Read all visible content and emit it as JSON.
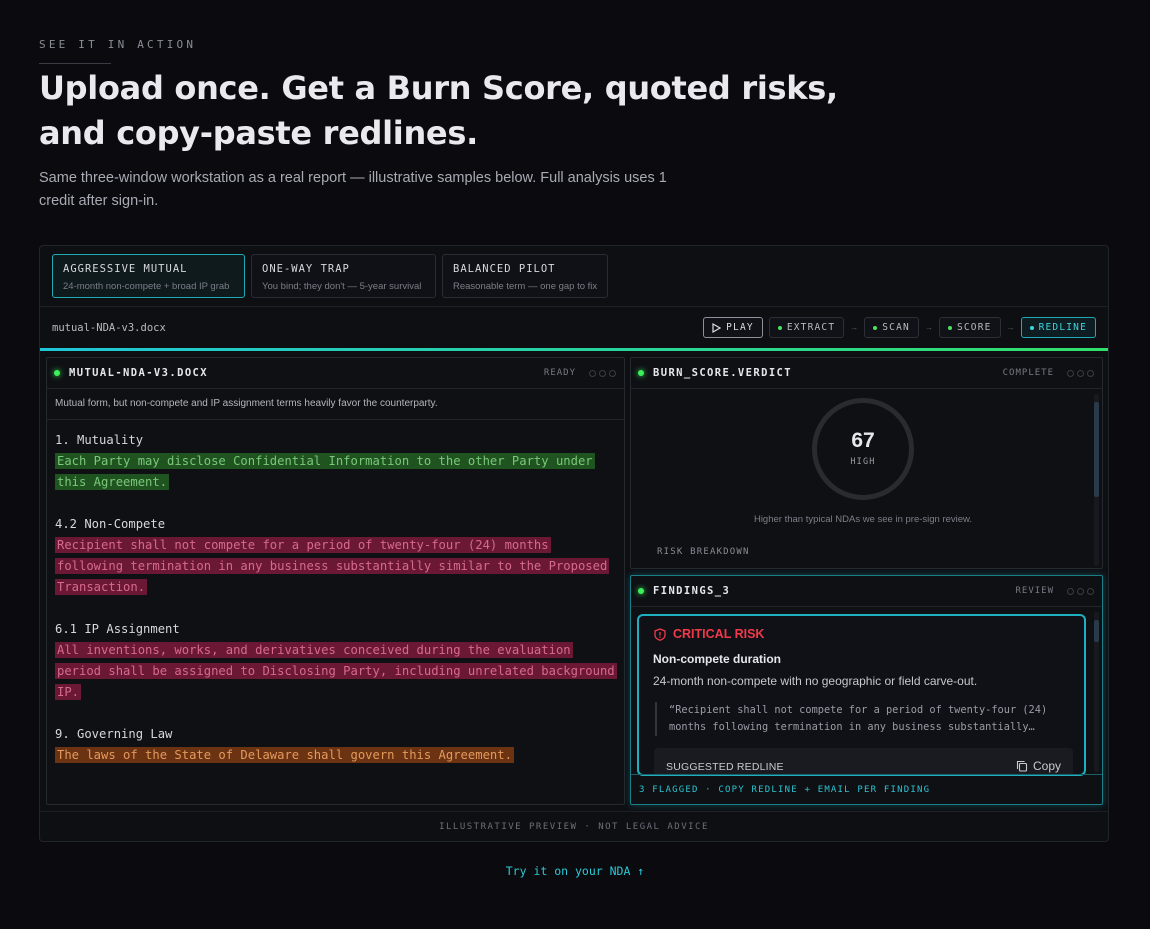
{
  "header": {
    "eyebrow": "SEE IT IN ACTION",
    "headline": "Upload once. Get a Burn Score, quoted risks, and copy-paste redlines.",
    "subtitle": "Same three-window workstation as a real report — illustrative samples below. Full analysis uses 1 credit after sign-in."
  },
  "tabs": [
    {
      "title": "AGGRESSIVE MUTUAL",
      "subtitle": "24-month non-compete + broad IP grab",
      "active": true
    },
    {
      "title": "ONE-WAY TRAP",
      "subtitle": "You bind; they don't — 5-year survival",
      "active": false
    },
    {
      "title": "BALANCED PILOT",
      "subtitle": "Reasonable term — one gap to fix",
      "active": false
    }
  ],
  "toolbar": {
    "filename": "mutual-NDA-v3.docx",
    "play_label": "PLAY",
    "steps": [
      "EXTRACT",
      "SCAN",
      "SCORE",
      "REDLINE"
    ],
    "arrow": "→"
  },
  "document_panel": {
    "title": "MUTUAL-NDA-V3.DOCX",
    "status": "READY",
    "description": "Mutual form, but non-compete and IP assignment terms heavily favor the counterparty.",
    "clauses": [
      {
        "heading": "1. Mutuality",
        "text": "Each Party may disclose Confidential Information to the other Party under this Agreement.",
        "risk": "green"
      },
      {
        "heading": "4.2 Non-Compete",
        "text": "Recipient shall not compete for a period of twenty-four (24) months following termination in any business substantially similar to the Proposed Transaction.",
        "risk": "red"
      },
      {
        "heading": "6.1 IP Assignment",
        "text": "All inventions, works, and derivatives conceived during the evaluation period shall be assigned to Disclosing Party, including unrelated background IP.",
        "risk": "red"
      },
      {
        "heading": "9. Governing Law",
        "text": "The laws of the State of Delaware shall govern this Agreement.",
        "risk": "orange"
      }
    ]
  },
  "score_panel": {
    "title": "BURN_SCORE.VERDICT",
    "status": "COMPLETE",
    "score": "67",
    "level": "HIGH",
    "note": "Higher than typical NDAs we see in pre-sign review.",
    "breakdown_label": "RISK BREAKDOWN"
  },
  "findings_panel": {
    "title": "FINDINGS_3",
    "status": "REVIEW",
    "card": {
      "severity": "CRITICAL RISK",
      "title": "Non-compete duration",
      "description": "24-month non-compete with no geographic or field carve-out.",
      "quote": "“Recipient shall not compete for a period of twenty-four (24) months following termination in any business substantially…",
      "redline_label": "SUGGESTED REDLINE",
      "copy_label": "Copy"
    },
    "footer": "3 FLAGGED · COPY REDLINE + EMAIL PER FINDING"
  },
  "frame_footer": "ILLUSTRATIVE PREVIEW · NOT LEGAL ADVICE",
  "cta": "Try it on your NDA ↑",
  "colors": {
    "accent": "#1fb0c0",
    "ok": "#3cf05a",
    "critical": "#f03a4a"
  }
}
